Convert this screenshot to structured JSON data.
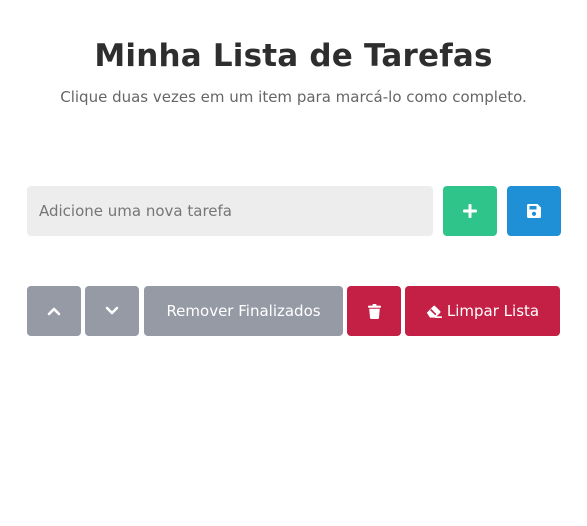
{
  "header": {
    "title": "Minha Lista de Tarefas",
    "subtitle": "Clique duas vezes em um item para marcá-lo como completo."
  },
  "new_task": {
    "placeholder": "Adicione uma nova tarefa",
    "value": "",
    "add_icon": "plus-icon",
    "save_icon": "floppy-disk-icon"
  },
  "toolbar": {
    "move_up_icon": "chevron-up-icon",
    "move_down_icon": "chevron-down-icon",
    "remove_finished_label": "Remover Finalizados",
    "delete_icon": "trash-icon",
    "clear_icon": "eraser-icon",
    "clear_list_label": "Limpar Lista"
  },
  "colors": {
    "title": "#2e2e2e",
    "subtitle": "#666666",
    "input_bg": "#ededed",
    "add_button": "#2ec48a",
    "save_button": "#1f8fd6",
    "neutral_button": "#959aa5",
    "danger_button": "#c41f44"
  }
}
